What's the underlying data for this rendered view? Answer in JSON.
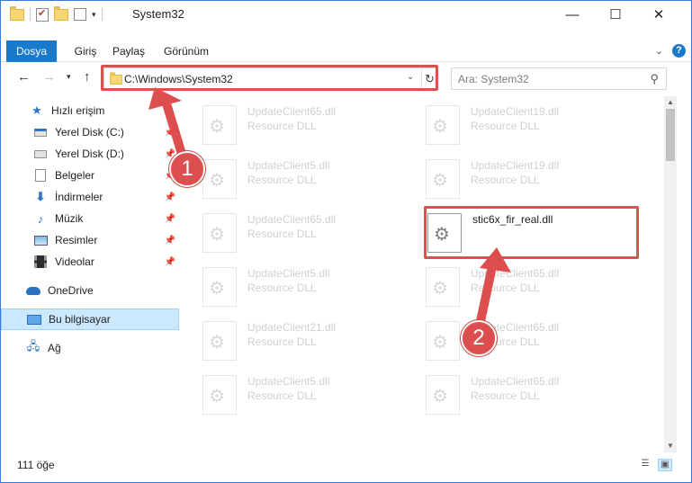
{
  "window": {
    "title": "System32",
    "minimize": "—",
    "maximize": "☐",
    "close": "✕"
  },
  "ribbon": {
    "tabs": [
      {
        "label": "Dosya"
      },
      {
        "label": "Giriş"
      },
      {
        "label": "Paylaş"
      },
      {
        "label": "Görünüm"
      }
    ],
    "help": "?"
  },
  "address": {
    "path": "C:\\Windows\\System32",
    "search_placeholder": "Ara: System32"
  },
  "sidebar": {
    "quick_access": "Hızlı erişim",
    "items": [
      {
        "label": "Yerel Disk (C:)",
        "icon": "system-drive-icon"
      },
      {
        "label": "Yerel Disk (D:)",
        "icon": "drive-icon"
      },
      {
        "label": "Belgeler",
        "icon": "documents-icon"
      },
      {
        "label": "İndirmeler",
        "icon": "downloads-icon"
      },
      {
        "label": "Müzik",
        "icon": "music-icon"
      },
      {
        "label": "Resimler",
        "icon": "pictures-icon"
      },
      {
        "label": "Videolar",
        "icon": "videos-icon"
      }
    ],
    "onedrive": "OneDrive",
    "this_pc": "Bu bilgisayar",
    "network": "Ağ"
  },
  "files": {
    "left_column": [
      {
        "name": "UpdateClient65.dll",
        "type": "Resource DLL"
      },
      {
        "name": "UpdateClient5.dll",
        "type": "Resource DLL"
      },
      {
        "name": "UpdateClient65.dll",
        "type": "Resource DLL"
      },
      {
        "name": "UpdateClient5.dll",
        "type": "Resource DLL"
      },
      {
        "name": "UpdateClient21.dll",
        "type": "Resource DLL"
      },
      {
        "name": "UpdateClient5.dll",
        "type": "Resource DLL"
      }
    ],
    "right_column": [
      {
        "name": "UpdateClient19.dll",
        "type": "Resource DLL"
      },
      {
        "name": "UpdateClient19.dll",
        "type": "Resource DLL"
      },
      {
        "name": "stic6x_fir_real.dll",
        "type": ""
      },
      {
        "name": "UpdateClient65.dll",
        "type": "Resource DLL"
      },
      {
        "name": "UpdateClient65.dll",
        "type": "Resource DLL"
      },
      {
        "name": "UpdateClient65.dll",
        "type": "Resource DLL"
      }
    ]
  },
  "annotations": {
    "step1": "1",
    "step2": "2",
    "color": "#dd4f4f"
  },
  "status": {
    "item_count": "111 öğe"
  }
}
